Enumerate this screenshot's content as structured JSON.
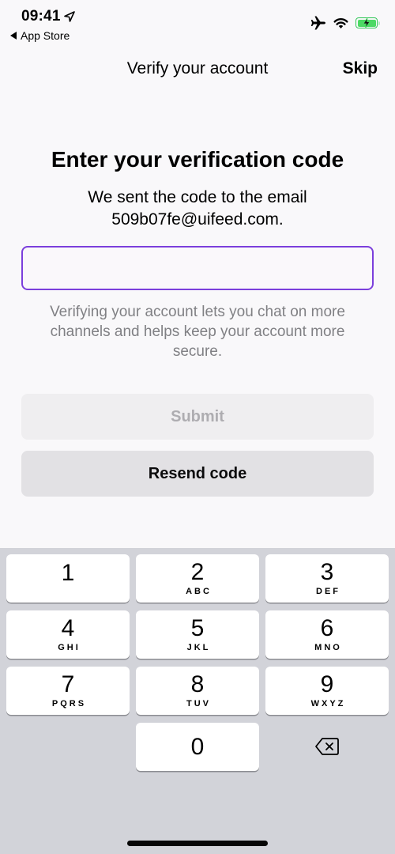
{
  "status_bar": {
    "time": "09:41",
    "back_app": "App Store",
    "icons": [
      "location-arrow-icon",
      "airplane-icon",
      "wifi-icon",
      "battery-charging-icon"
    ]
  },
  "nav": {
    "title": "Verify your account",
    "skip_label": "Skip"
  },
  "main": {
    "heading": "Enter your verification code",
    "subtitle_line1": "We sent the code to the email",
    "email": "509b07fe@uifeed.com.",
    "code_input": {
      "value": "",
      "placeholder": ""
    },
    "helper_text": "Verifying your account lets you chat on more channels and helps keep your account more secure.",
    "submit_label": "Submit",
    "resend_label": "Resend code"
  },
  "colors": {
    "accent": "#7b3fdc",
    "background": "#f9f8fa",
    "keyboard_bg": "#d2d3d9",
    "helper_text": "#808084",
    "disabled_text": "#aeadb1"
  },
  "keyboard": {
    "keys": [
      {
        "num": "1",
        "letters": ""
      },
      {
        "num": "2",
        "letters": "ABC"
      },
      {
        "num": "3",
        "letters": "DEF"
      },
      {
        "num": "4",
        "letters": "GHI"
      },
      {
        "num": "5",
        "letters": "JKL"
      },
      {
        "num": "6",
        "letters": "MNO"
      },
      {
        "num": "7",
        "letters": "PQRS"
      },
      {
        "num": "8",
        "letters": "TUV"
      },
      {
        "num": "9",
        "letters": "WXYZ"
      },
      {
        "num": "0",
        "letters": ""
      }
    ],
    "delete_icon": "backspace-icon"
  }
}
